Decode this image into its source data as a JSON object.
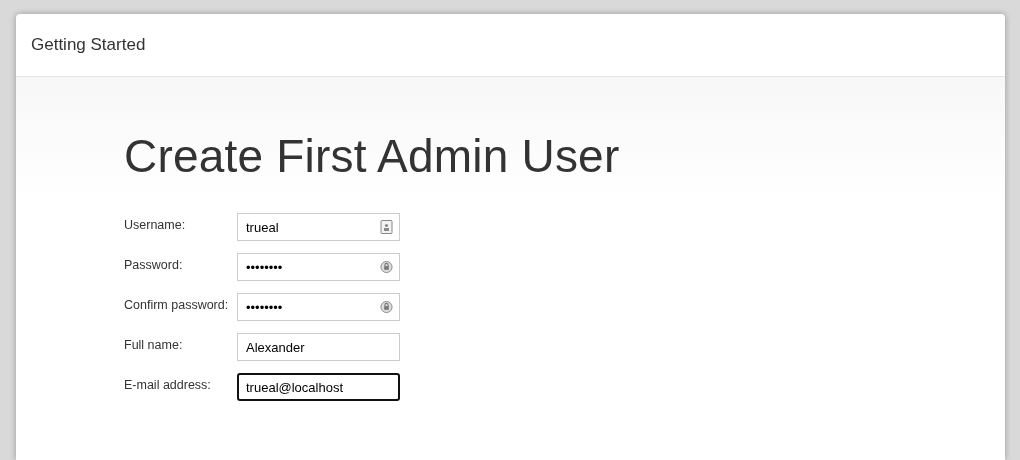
{
  "window": {
    "title": "Getting Started"
  },
  "heading": "Create First Admin User",
  "fields": [
    {
      "label": "Username:",
      "value": "trueal",
      "kind": "username",
      "focused": false
    },
    {
      "label": "Password:",
      "value": "••••••••",
      "kind": "password",
      "focused": false
    },
    {
      "label": "Confirm password:",
      "value": "••••••••",
      "kind": "password",
      "focused": false
    },
    {
      "label": "Full name:",
      "value": "Alexander",
      "kind": "text",
      "focused": false
    },
    {
      "label": "E-mail address:",
      "value": "trueal@localhost",
      "kind": "text",
      "focused": true
    }
  ]
}
